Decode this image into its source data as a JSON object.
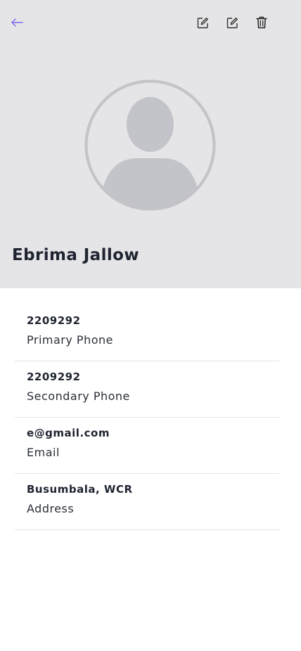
{
  "header": {
    "back_icon": "arrow-left-icon",
    "actions": [
      {
        "icon": "edit-icon"
      },
      {
        "icon": "edit-icon"
      },
      {
        "icon": "trash-icon"
      }
    ],
    "avatar_icon": "person-placeholder-icon",
    "name": "Ebrima Jallow",
    "accent_color": "#7b68ee",
    "background_color": "#e5e5e7"
  },
  "details": [
    {
      "value": "2209292",
      "label": "Primary Phone"
    },
    {
      "value": "2209292",
      "label": "Secondary Phone"
    },
    {
      "value": "e@gmail.com",
      "label": "Email"
    },
    {
      "value": "Busumbala, WCR",
      "label": "Address"
    }
  ]
}
